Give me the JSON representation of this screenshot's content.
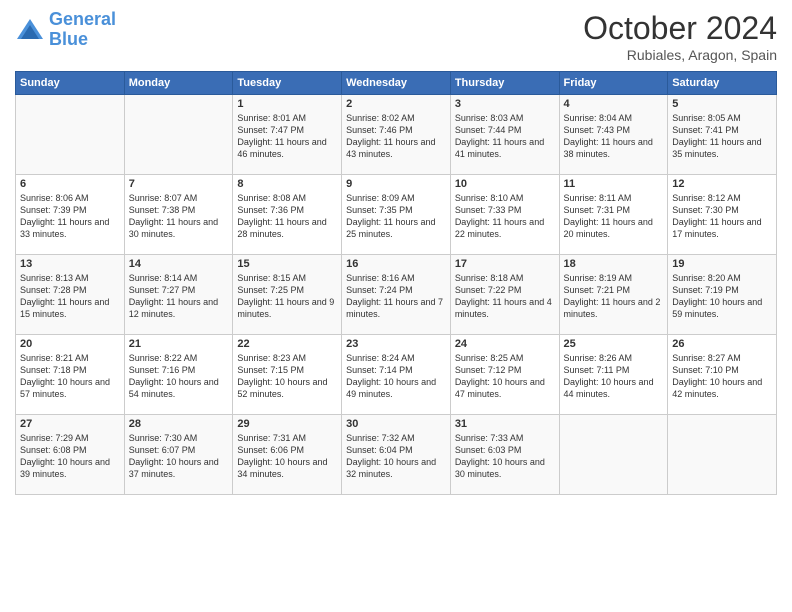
{
  "header": {
    "logo_line1": "General",
    "logo_line2": "Blue",
    "month": "October 2024",
    "location": "Rubiales, Aragon, Spain"
  },
  "days_of_week": [
    "Sunday",
    "Monday",
    "Tuesday",
    "Wednesday",
    "Thursday",
    "Friday",
    "Saturday"
  ],
  "weeks": [
    [
      {
        "day": "",
        "info": ""
      },
      {
        "day": "",
        "info": ""
      },
      {
        "day": "1",
        "info": "Sunrise: 8:01 AM\nSunset: 7:47 PM\nDaylight: 11 hours and 46 minutes."
      },
      {
        "day": "2",
        "info": "Sunrise: 8:02 AM\nSunset: 7:46 PM\nDaylight: 11 hours and 43 minutes."
      },
      {
        "day": "3",
        "info": "Sunrise: 8:03 AM\nSunset: 7:44 PM\nDaylight: 11 hours and 41 minutes."
      },
      {
        "day": "4",
        "info": "Sunrise: 8:04 AM\nSunset: 7:43 PM\nDaylight: 11 hours and 38 minutes."
      },
      {
        "day": "5",
        "info": "Sunrise: 8:05 AM\nSunset: 7:41 PM\nDaylight: 11 hours and 35 minutes."
      }
    ],
    [
      {
        "day": "6",
        "info": "Sunrise: 8:06 AM\nSunset: 7:39 PM\nDaylight: 11 hours and 33 minutes."
      },
      {
        "day": "7",
        "info": "Sunrise: 8:07 AM\nSunset: 7:38 PM\nDaylight: 11 hours and 30 minutes."
      },
      {
        "day": "8",
        "info": "Sunrise: 8:08 AM\nSunset: 7:36 PM\nDaylight: 11 hours and 28 minutes."
      },
      {
        "day": "9",
        "info": "Sunrise: 8:09 AM\nSunset: 7:35 PM\nDaylight: 11 hours and 25 minutes."
      },
      {
        "day": "10",
        "info": "Sunrise: 8:10 AM\nSunset: 7:33 PM\nDaylight: 11 hours and 22 minutes."
      },
      {
        "day": "11",
        "info": "Sunrise: 8:11 AM\nSunset: 7:31 PM\nDaylight: 11 hours and 20 minutes."
      },
      {
        "day": "12",
        "info": "Sunrise: 8:12 AM\nSunset: 7:30 PM\nDaylight: 11 hours and 17 minutes."
      }
    ],
    [
      {
        "day": "13",
        "info": "Sunrise: 8:13 AM\nSunset: 7:28 PM\nDaylight: 11 hours and 15 minutes."
      },
      {
        "day": "14",
        "info": "Sunrise: 8:14 AM\nSunset: 7:27 PM\nDaylight: 11 hours and 12 minutes."
      },
      {
        "day": "15",
        "info": "Sunrise: 8:15 AM\nSunset: 7:25 PM\nDaylight: 11 hours and 9 minutes."
      },
      {
        "day": "16",
        "info": "Sunrise: 8:16 AM\nSunset: 7:24 PM\nDaylight: 11 hours and 7 minutes."
      },
      {
        "day": "17",
        "info": "Sunrise: 8:18 AM\nSunset: 7:22 PM\nDaylight: 11 hours and 4 minutes."
      },
      {
        "day": "18",
        "info": "Sunrise: 8:19 AM\nSunset: 7:21 PM\nDaylight: 11 hours and 2 minutes."
      },
      {
        "day": "19",
        "info": "Sunrise: 8:20 AM\nSunset: 7:19 PM\nDaylight: 10 hours and 59 minutes."
      }
    ],
    [
      {
        "day": "20",
        "info": "Sunrise: 8:21 AM\nSunset: 7:18 PM\nDaylight: 10 hours and 57 minutes."
      },
      {
        "day": "21",
        "info": "Sunrise: 8:22 AM\nSunset: 7:16 PM\nDaylight: 10 hours and 54 minutes."
      },
      {
        "day": "22",
        "info": "Sunrise: 8:23 AM\nSunset: 7:15 PM\nDaylight: 10 hours and 52 minutes."
      },
      {
        "day": "23",
        "info": "Sunrise: 8:24 AM\nSunset: 7:14 PM\nDaylight: 10 hours and 49 minutes."
      },
      {
        "day": "24",
        "info": "Sunrise: 8:25 AM\nSunset: 7:12 PM\nDaylight: 10 hours and 47 minutes."
      },
      {
        "day": "25",
        "info": "Sunrise: 8:26 AM\nSunset: 7:11 PM\nDaylight: 10 hours and 44 minutes."
      },
      {
        "day": "26",
        "info": "Sunrise: 8:27 AM\nSunset: 7:10 PM\nDaylight: 10 hours and 42 minutes."
      }
    ],
    [
      {
        "day": "27",
        "info": "Sunrise: 7:29 AM\nSunset: 6:08 PM\nDaylight: 10 hours and 39 minutes."
      },
      {
        "day": "28",
        "info": "Sunrise: 7:30 AM\nSunset: 6:07 PM\nDaylight: 10 hours and 37 minutes."
      },
      {
        "day": "29",
        "info": "Sunrise: 7:31 AM\nSunset: 6:06 PM\nDaylight: 10 hours and 34 minutes."
      },
      {
        "day": "30",
        "info": "Sunrise: 7:32 AM\nSunset: 6:04 PM\nDaylight: 10 hours and 32 minutes."
      },
      {
        "day": "31",
        "info": "Sunrise: 7:33 AM\nSunset: 6:03 PM\nDaylight: 10 hours and 30 minutes."
      },
      {
        "day": "",
        "info": ""
      },
      {
        "day": "",
        "info": ""
      }
    ]
  ]
}
